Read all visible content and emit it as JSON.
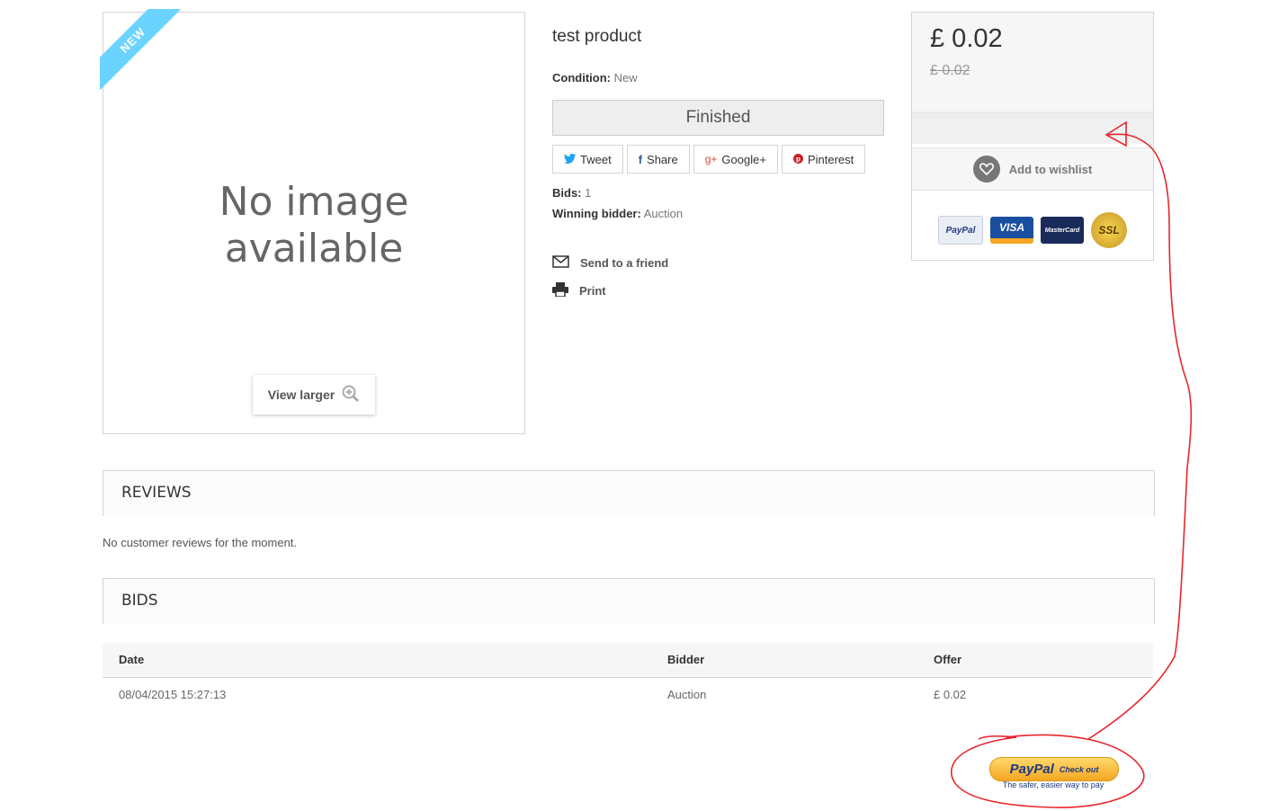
{
  "product_image": {
    "placeholder_line1": "No image",
    "placeholder_line2": "available",
    "ribbon": "NEW",
    "view_larger": "View larger"
  },
  "product": {
    "title": "test product",
    "condition_label": "Condition:",
    "condition_value": "New",
    "status": "Finished",
    "bids_label": "Bids:",
    "bids_value": "1",
    "winner_label": "Winning bidder:",
    "winner_value": "Auction"
  },
  "share": {
    "tweet": "Tweet",
    "share": "Share",
    "google": "Google+",
    "pinterest": "Pinterest"
  },
  "actions": {
    "send_friend": "Send to a friend",
    "print": "Print"
  },
  "price_box": {
    "price": "£ 0.02",
    "old_price": "£ 0.02",
    "wishlist": "Add to wishlist",
    "cards": [
      "PayPal",
      "VISA",
      "MasterCard",
      "SSL"
    ]
  },
  "reviews": {
    "title": "REVIEWS",
    "empty": "No customer reviews for the moment."
  },
  "bids": {
    "title": "BIDS",
    "columns": [
      "Date",
      "Bidder",
      "Offer"
    ],
    "rows": [
      [
        "08/04/2015 15:27:13",
        "Auction",
        "£ 0.02"
      ]
    ]
  },
  "paypal_checkout": {
    "brand": "PayPal",
    "label": "Check out",
    "tagline": "The safer, easier way to pay"
  },
  "colors": {
    "ribbon": "#6ad4ff",
    "annotation": "#e8262d",
    "paypal_gold": "#f5a623",
    "paypal_blue": "#1e3a80"
  }
}
